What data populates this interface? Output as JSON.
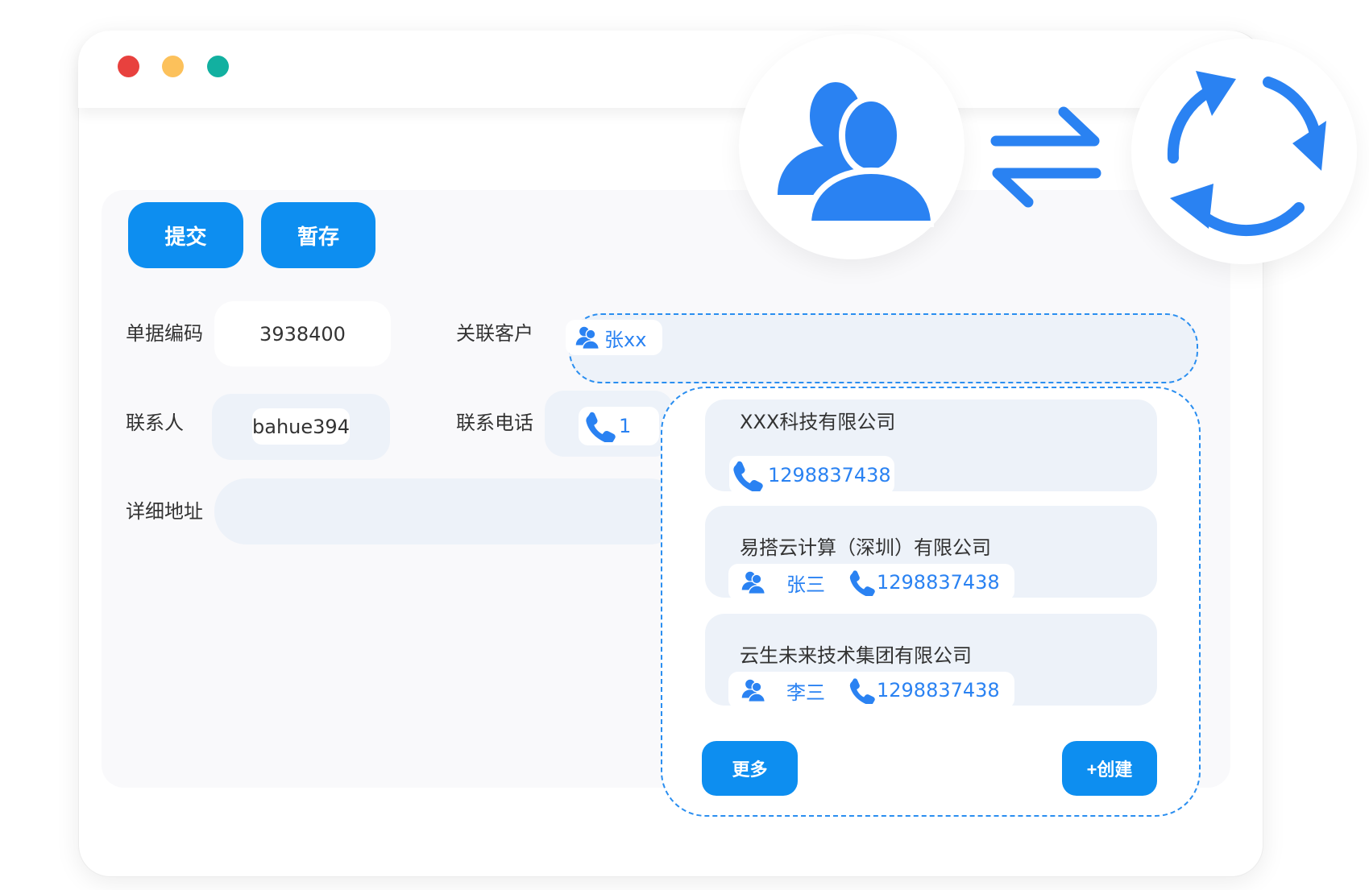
{
  "colors": {
    "accent": "#0d8ef0",
    "icon_blue": "#2a82f2",
    "field_bg": "#edf2f9",
    "dot_red": "#e8413e",
    "dot_yellow": "#fcc15b",
    "dot_green": "#12b0a0"
  },
  "window": {
    "controls": [
      "close-dot",
      "minimize-dot",
      "maximize-dot"
    ]
  },
  "toolbar": {
    "submit_label": "提交",
    "save_draft_label": "暂存"
  },
  "form": {
    "doc_code": {
      "label": "单据编码",
      "value": "3938400"
    },
    "customer": {
      "label": "关联客户",
      "chip_text": "张xx",
      "chip_icon": "users-icon"
    },
    "contact": {
      "label": "联系人",
      "value": "bahue394"
    },
    "phone": {
      "label": "联系电话",
      "partial_value": "1",
      "icon": "phone-icon"
    },
    "address": {
      "label": "详细地址",
      "value": ""
    }
  },
  "dropdown": {
    "items": [
      {
        "company": "XXX科技有限公司",
        "phone": "1298837438"
      },
      {
        "company": "易搭云计算（深圳）有限公司",
        "contact": "张三",
        "phone": "1298837438"
      },
      {
        "company": "云生未来技术集团有限公司",
        "contact": "李三",
        "phone": "1298837438"
      }
    ],
    "more_label": "更多",
    "create_label": "+创建"
  },
  "illustration": {
    "left_icon": "users-icon",
    "middle_icon": "swap-arrows-icon",
    "right_icon": "sync-icon"
  }
}
